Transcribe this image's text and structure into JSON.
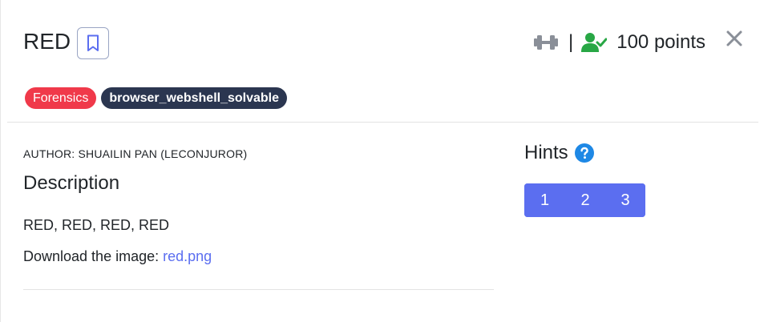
{
  "challenge": {
    "title": "RED",
    "tags": [
      {
        "label": "Forensics",
        "color": "#f0394a"
      },
      {
        "label": "browser_webshell_solvable",
        "color": "#2b3650"
      }
    ],
    "separator": "|",
    "points": "100 points",
    "author": "AUTHOR: SHUAILIN PAN (LECONJUROR)",
    "description_heading": "Description",
    "description_text": "RED, RED, RED, RED",
    "download_prefix": "Download the image: ",
    "download_link": "red.png"
  },
  "hints": {
    "title": "Hints",
    "buttons": [
      "1",
      "2",
      "3"
    ]
  },
  "icons": {
    "bookmark": "bookmark-icon",
    "difficulty": "dumbbell-icon",
    "solved": "user-check-icon",
    "close": "close-icon",
    "help": "question-circle-icon"
  },
  "colors": {
    "accent": "#5b6ef0",
    "forensics_tag": "#f0394a",
    "navy_tag": "#2b3650",
    "solved_green": "#28a745",
    "help_blue": "#1e88e5"
  }
}
